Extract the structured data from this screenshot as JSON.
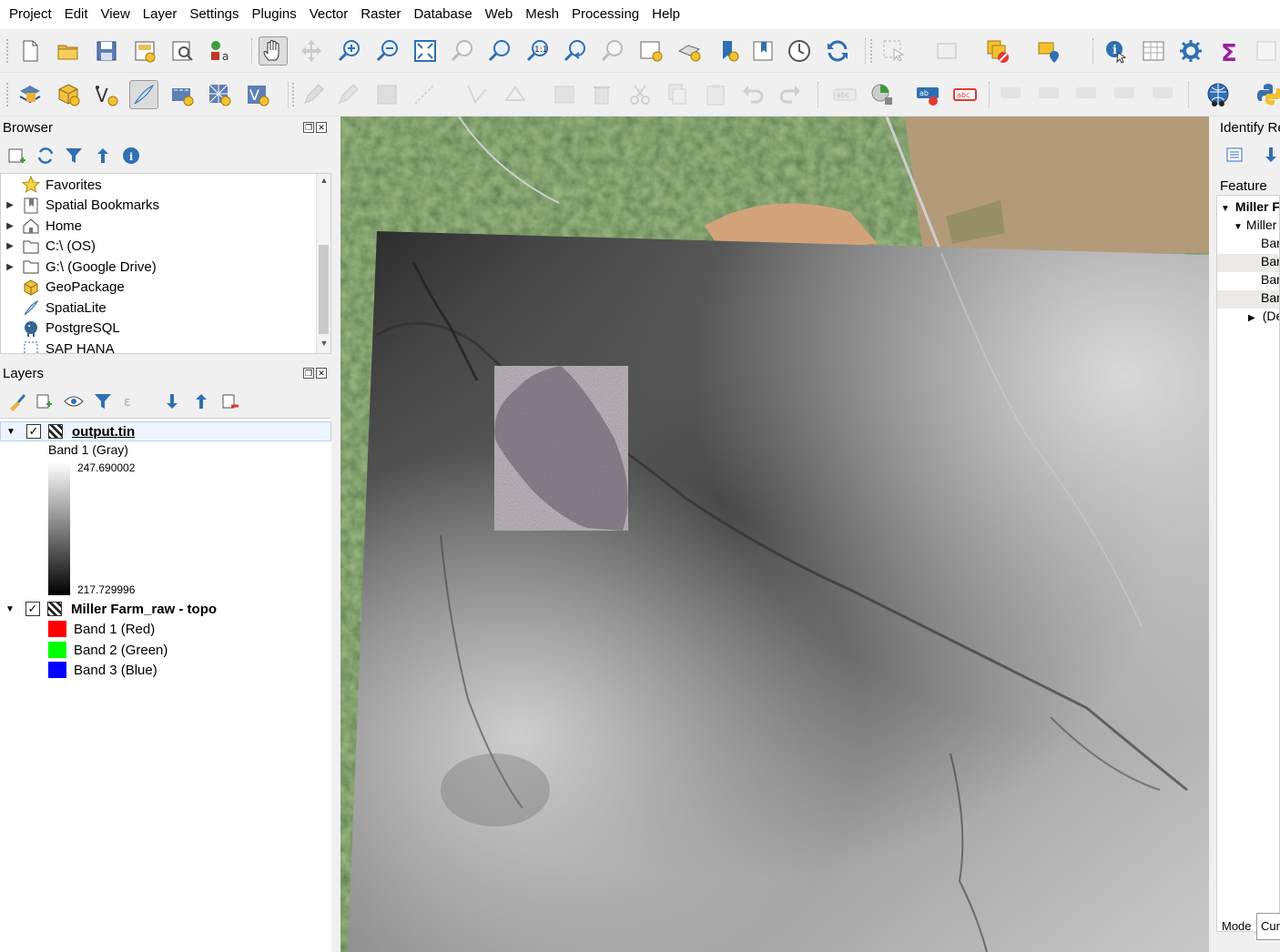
{
  "menu": [
    "Project",
    "Edit",
    "View",
    "Layer",
    "Settings",
    "Plugins",
    "Vector",
    "Raster",
    "Database",
    "Web",
    "Mesh",
    "Processing",
    "Help"
  ],
  "toolbar1": {
    "icons": [
      "new-project-icon",
      "open-project-icon",
      "save-project-icon",
      "new-print-layout-icon",
      "layout-manager-icon",
      "style-manager-icon",
      "pan-icon",
      "pan-to-selection-icon",
      "zoom-in-icon",
      "zoom-out-icon",
      "zoom-full-icon",
      "zoom-to-selection-icon",
      "zoom-to-layer-icon",
      "zoom-native-icon",
      "zoom-last-icon",
      "zoom-next-icon",
      "new-map-view-icon",
      "new-3d-map-icon",
      "new-bookmark-icon",
      "show-bookmarks-icon",
      "temporal-controller-icon",
      "refresh-icon",
      "select-features-icon",
      "select-by-value-icon",
      "deselect-icon",
      "select-location-icon",
      "identify-icon",
      "attribute-table-icon",
      "toolbox-icon",
      "statistics-icon",
      "spacer"
    ]
  },
  "toolbar2": {
    "icons": [
      "data-source-manager-icon",
      "new-geopackage-icon",
      "new-shapefile-icon",
      "new-spatialite-icon",
      "new-virtual-layer-icon",
      "new-mesh-icon",
      "new-temporary-layer-icon"
    ]
  },
  "browser": {
    "title": "Browser",
    "items": [
      {
        "label": "Favorites",
        "icon": "star-icon",
        "expandable": false
      },
      {
        "label": "Spatial Bookmarks",
        "icon": "bookmark-icon",
        "expandable": true
      },
      {
        "label": "Home",
        "icon": "home-icon",
        "expandable": true
      },
      {
        "label": "C:\\ (OS)",
        "icon": "folder-icon",
        "expandable": true
      },
      {
        "label": "G:\\ (Google Drive)",
        "icon": "folder-icon",
        "expandable": true
      },
      {
        "label": "GeoPackage",
        "icon": "geopackage-icon",
        "expandable": false
      },
      {
        "label": "SpatiaLite",
        "icon": "spatialite-icon",
        "expandable": false
      },
      {
        "label": "PostgreSQL",
        "icon": "postgresql-icon",
        "expandable": false
      },
      {
        "label": "SAP HANA",
        "icon": "sap-hana-icon",
        "expandable": false
      }
    ]
  },
  "layers": {
    "title": "Layers",
    "items": [
      {
        "name": "output.tin",
        "checked": true,
        "band": "Band 1 (Gray)",
        "max": "247.690002",
        "min": "217.729996"
      },
      {
        "name": "Miller Farm_raw - topo",
        "checked": true,
        "bands": [
          {
            "label": "Band 1 (Red)",
            "color": "#ff0000"
          },
          {
            "label": "Band 2 (Green)",
            "color": "#00ff00"
          },
          {
            "label": "Band 3 (Blue)",
            "color": "#0000ff"
          }
        ]
      }
    ]
  },
  "identify": {
    "title": "Identify Re",
    "feature_header": "Feature",
    "rows": [
      "Miller F",
      "Miller",
      "Bar",
      "Bar",
      "Bar",
      "Bar",
      "(De"
    ],
    "mode_label": "Mode",
    "mode_value": "Cur"
  }
}
